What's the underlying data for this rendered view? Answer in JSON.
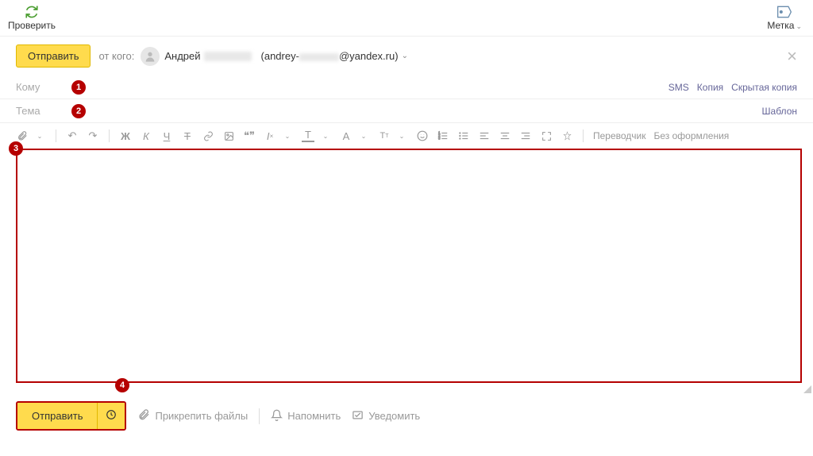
{
  "topbar": {
    "check": "Проверить",
    "tag": "Метка"
  },
  "header": {
    "send": "Отправить",
    "from_label": "от кого:",
    "from_name": "Андрей",
    "email_prefix": "(andrey-",
    "email_suffix": "@yandex.ru)"
  },
  "fields": {
    "to": "Кому",
    "subject": "Тема",
    "sms": "SMS",
    "cc": "Копия",
    "bcc": "Скрытая копия",
    "template": "Шаблон"
  },
  "toolbar": {
    "bold": "Ж",
    "italic": "К",
    "underline": "Ч",
    "strike": "Т",
    "translator": "Переводчик",
    "noformat": "Без оформления"
  },
  "bottom": {
    "send": "Отправить",
    "attach": "Прикрепить файлы",
    "remind": "Напомнить",
    "notify": "Уведомить"
  },
  "markers": {
    "m1": "1",
    "m2": "2",
    "m3": "3",
    "m4": "4"
  }
}
